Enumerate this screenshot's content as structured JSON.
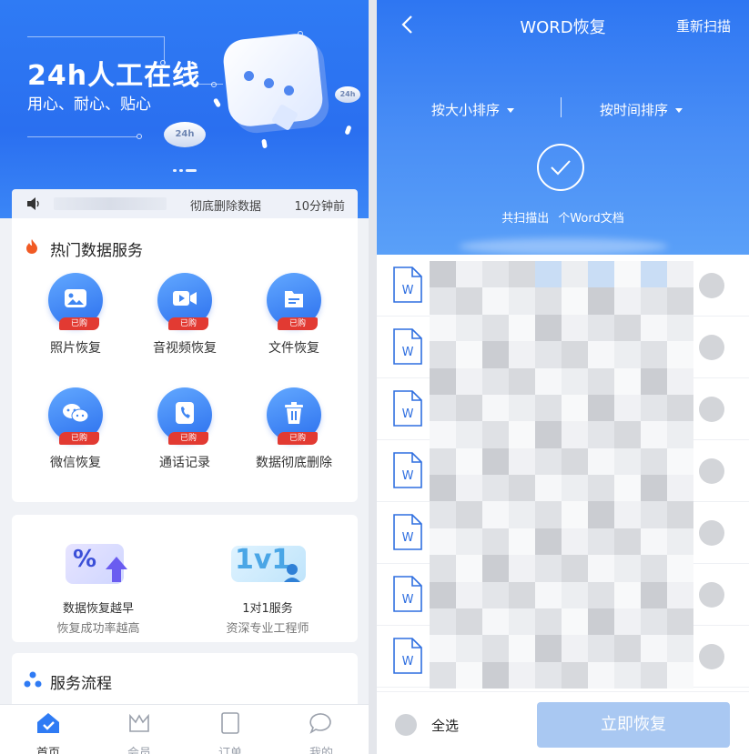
{
  "left": {
    "banner": {
      "title": "24h人工在线",
      "subtitle": "用心、耐心、贴心",
      "coin_label_1": "24h",
      "coin_label_2": "24h"
    },
    "notice": {
      "action": "彻底删除数据",
      "time": "10分钟前"
    },
    "hot_section": {
      "title": "热门数据服务",
      "owned_badge": "已购",
      "services": [
        {
          "label": "照片恢复",
          "icon": "photo-icon"
        },
        {
          "label": "音视频恢复",
          "icon": "video-icon"
        },
        {
          "label": "文件恢复",
          "icon": "file-icon"
        },
        {
          "label": "微信恢复",
          "icon": "wechat-icon"
        },
        {
          "label": "通话记录",
          "icon": "call-log-icon"
        },
        {
          "label": "数据彻底删除",
          "icon": "trash-icon"
        }
      ]
    },
    "advantages": [
      {
        "title": "数据恢复越早",
        "subtitle": "恢复成功率越高",
        "art": "%"
      },
      {
        "title": "1对1服务",
        "subtitle": "资深专业工程师",
        "art": "1v1"
      }
    ],
    "flow_section": {
      "title": "服务流程"
    },
    "tabbar": [
      {
        "label": "首页",
        "icon": "home-icon",
        "active": true
      },
      {
        "label": "会员",
        "icon": "crown-icon",
        "active": false
      },
      {
        "label": "订单",
        "icon": "order-icon",
        "active": false
      },
      {
        "label": "我的",
        "icon": "chat-bubble-icon",
        "active": false
      }
    ]
  },
  "right": {
    "title": "WORD恢复",
    "rescan": "重新扫描",
    "sort_by_size": "按大小排序",
    "sort_by_time": "按时间排序",
    "scan_result_prefix": "共扫描出",
    "scan_result_suffix": "个Word文档",
    "file_icon_letter": "W",
    "select_all": "全选",
    "recover_button": "立即恢复"
  },
  "colors": {
    "brand_blue": "#2f7bf4",
    "owned_red": "#e23a32",
    "disabled_button": "#a9c8f2"
  }
}
